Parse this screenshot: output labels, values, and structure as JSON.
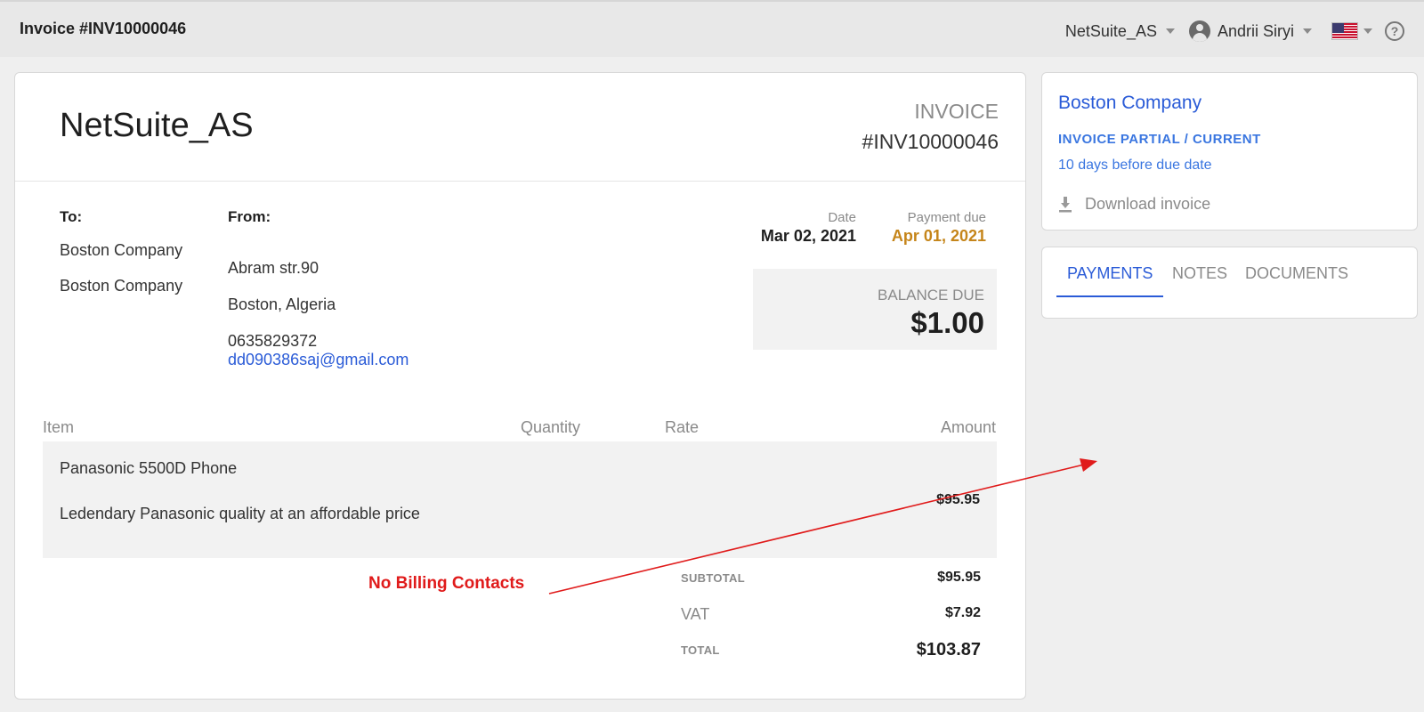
{
  "topbar": {
    "title": "Invoice #INV10000046",
    "org": "NetSuite_AS",
    "user": "Andrii Siryi",
    "help_glyph": "?"
  },
  "invoice": {
    "company_name": "NetSuite_AS",
    "label": "INVOICE",
    "number": "#INV10000046",
    "to": {
      "label": "To:",
      "lines": [
        "Boston Company",
        "Boston Company"
      ]
    },
    "from": {
      "label": "From:",
      "street": "Abram str.90",
      "city": "Boston, Algeria",
      "phone": "0635829372",
      "email": "dd090386saj@gmail.com"
    },
    "date": {
      "label": "Date",
      "value": "Mar 02, 2021"
    },
    "payment_due": {
      "label": "Payment due",
      "value": "Apr 01, 2021"
    },
    "balance_due": {
      "label": "BALANCE DUE",
      "value": "$1.00"
    },
    "table": {
      "headers": {
        "item": "Item",
        "quantity": "Quantity",
        "rate": "Rate",
        "amount": "Amount"
      },
      "rows": [
        {
          "name": "Panasonic 5500D Phone",
          "description": "Ledendary Panasonic quality at an affordable price",
          "amount": "$95.95"
        }
      ]
    },
    "totals": {
      "subtotal_label": "SUBTOTAL",
      "subtotal": "$95.95",
      "vat_label": "VAT",
      "vat": "$7.92",
      "total_label": "TOTAL",
      "total": "$103.87"
    }
  },
  "annotation": {
    "text": "No Billing Contacts",
    "color": "#e01b1b"
  },
  "side": {
    "company": "Boston Company",
    "status": "INVOICE PARTIAL / CURRENT",
    "due_note": "10 days before due date",
    "download_label": "Download invoice"
  },
  "tabs": [
    {
      "label": "PAYMENTS",
      "active": true
    },
    {
      "label": "NOTES",
      "active": false
    },
    {
      "label": "DOCUMENTS",
      "active": false
    }
  ],
  "icons": [
    "user-avatar-icon",
    "us-flag-icon",
    "help-icon",
    "download-icon",
    "caret-down-icon"
  ],
  "colors": {
    "link": "#2a5bd7",
    "status": "#3a76e0",
    "due": "#c5851a"
  }
}
